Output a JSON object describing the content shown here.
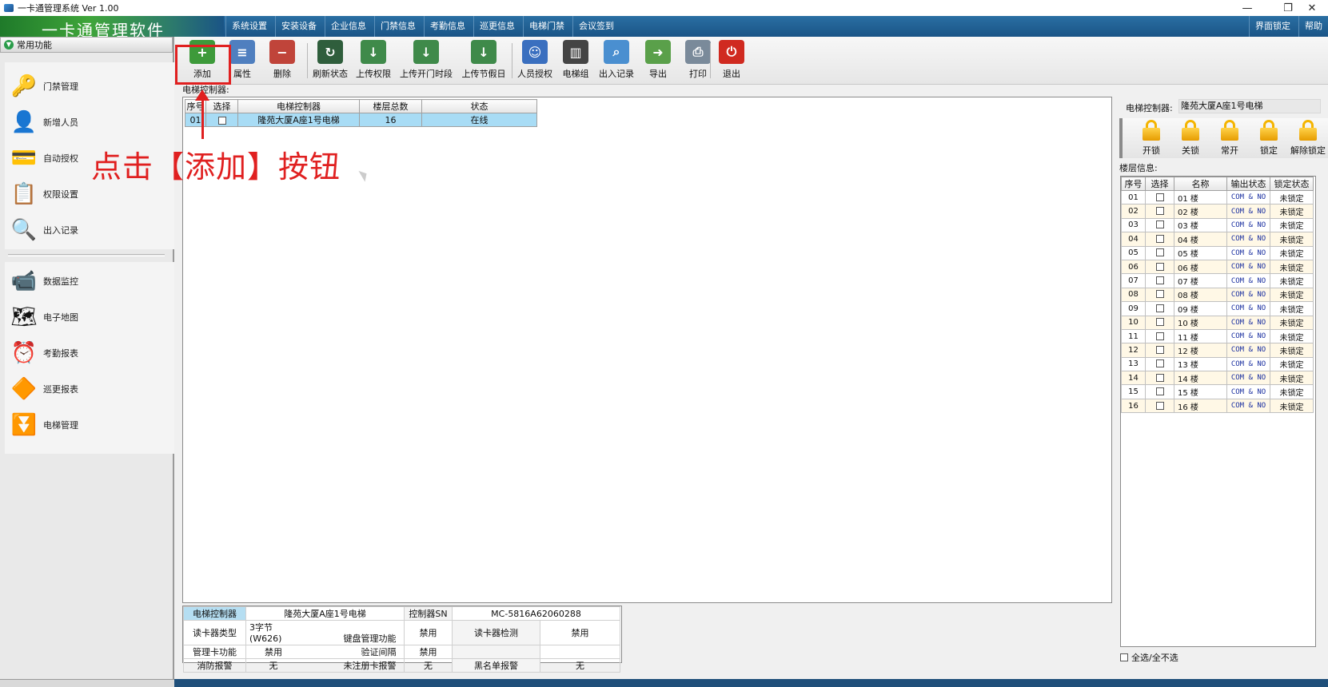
{
  "window": {
    "title": "一卡通管理系统 Ver 1.00",
    "minimize": "—",
    "restore": "❐",
    "close": "✕"
  },
  "menubar": {
    "logo": "一卡通管理软件",
    "items": [
      "系统设置",
      "安装设备",
      "企业信息",
      "门禁信息",
      "考勤信息",
      "巡更信息",
      "电梯门禁",
      "会议签到"
    ],
    "right_items": [
      "界面锁定",
      "帮助"
    ]
  },
  "sidebar": {
    "header": "常用功能",
    "items": [
      {
        "label": "门禁管理",
        "icon": "door-access-icon"
      },
      {
        "label": "新增人员",
        "icon": "person-icon"
      },
      {
        "label": "自动授权",
        "icon": "card-icon"
      },
      {
        "label": "权限设置",
        "icon": "permission-icon"
      },
      {
        "label": "出入记录",
        "icon": "magnifier-icon"
      },
      {
        "label": "数据监控",
        "icon": "camera-icon"
      },
      {
        "label": "电子地图",
        "icon": "map-icon"
      },
      {
        "label": "考勤报表",
        "icon": "clock-icon"
      },
      {
        "label": "巡更报表",
        "icon": "patrol-icon"
      },
      {
        "label": "电梯管理",
        "icon": "elevator-icon"
      }
    ]
  },
  "toolbar": {
    "buttons": [
      {
        "label": "添加",
        "icon": "add-icon",
        "color": "#3d9a3a",
        "glyph": "+"
      },
      {
        "label": "属性",
        "icon": "properties-icon",
        "color": "#4f7fbf",
        "glyph": "≡"
      },
      {
        "label": "删除",
        "icon": "delete-icon",
        "color": "#c0443a",
        "glyph": "−"
      },
      {
        "label": "刷新状态",
        "icon": "refresh-icon",
        "color": "#2f5e3c",
        "glyph": "↻"
      },
      {
        "label": "上传权限",
        "icon": "upload-permission-icon",
        "color": "#3f8a4a",
        "glyph": "↓"
      },
      {
        "label": "上传开门时段",
        "icon": "upload-timeslot-icon",
        "color": "#3f8a4a",
        "glyph": "↓"
      },
      {
        "label": "上传节假日",
        "icon": "upload-holiday-icon",
        "color": "#3f8a4a",
        "glyph": "↓"
      },
      {
        "label": "人员授权",
        "icon": "person-auth-icon",
        "color": "#3a6fbf",
        "glyph": "☺"
      },
      {
        "label": "电梯组",
        "icon": "elevator-group-icon",
        "color": "#444444",
        "glyph": "▥"
      },
      {
        "label": "出入记录",
        "icon": "records-search-icon",
        "color": "#4a8fd0",
        "glyph": "⌕"
      },
      {
        "label": "导出",
        "icon": "export-icon",
        "color": "#5aa04a",
        "glyph": "➜"
      },
      {
        "label": "打印",
        "icon": "print-icon",
        "color": "#7a8a9a",
        "glyph": "⎙"
      },
      {
        "label": "退出",
        "icon": "exit-icon",
        "color": "#d02a20",
        "glyph": "⏻"
      }
    ]
  },
  "main": {
    "caption": "电梯控制器:",
    "columns": [
      "序号",
      "选择",
      "电梯控制器",
      "楼层总数",
      "状态"
    ],
    "rows": [
      {
        "no": "01",
        "name": "隆苑大厦A座1号电梯",
        "floors": "16",
        "status": "在线"
      }
    ]
  },
  "annotation": {
    "text": "点击【添加】按钮"
  },
  "details": {
    "controller_label": "电梯控制器",
    "controller_value": "隆苑大厦A座1号电梯",
    "sn_label": "控制器SN",
    "sn_value": "MC-5816A62060288",
    "reader_type_label": "读卡器类型",
    "reader_type_value": "3字节(W626)",
    "keypad_label": "键盘管理功能",
    "keypad_value": "禁用",
    "reader_detect_label": "读卡器检测",
    "reader_detect_value": "禁用",
    "admin_card_label": "管理卡功能",
    "admin_card_value": "禁用",
    "verify_label": "验证间隔",
    "verify_value": "禁用",
    "fire_label": "消防报警",
    "fire_value": "无",
    "unreg_label": "未注册卡报警",
    "unreg_value": "无",
    "blacklist_label": "黑名单报警",
    "blacklist_value": "无"
  },
  "right": {
    "controller_label": "电梯控制器:",
    "controller_value": "隆苑大厦A座1号电梯",
    "lock_buttons": [
      "开锁",
      "关锁",
      "常开",
      "锁定",
      "解除锁定"
    ],
    "floor_caption": "楼层信息:",
    "floor_columns": [
      "序号",
      "选择",
      "名称",
      "输出状态",
      "锁定状态"
    ],
    "floors": [
      {
        "no": "01",
        "name": "01 楼",
        "out": "COM & NO",
        "lock": "未锁定"
      },
      {
        "no": "02",
        "name": "02 楼",
        "out": "COM & NO",
        "lock": "未锁定"
      },
      {
        "no": "03",
        "name": "03 楼",
        "out": "COM & NO",
        "lock": "未锁定"
      },
      {
        "no": "04",
        "name": "04 楼",
        "out": "COM & NO",
        "lock": "未锁定"
      },
      {
        "no": "05",
        "name": "05 楼",
        "out": "COM & NO",
        "lock": "未锁定"
      },
      {
        "no": "06",
        "name": "06 楼",
        "out": "COM & NO",
        "lock": "未锁定"
      },
      {
        "no": "07",
        "name": "07 楼",
        "out": "COM & NO",
        "lock": "未锁定"
      },
      {
        "no": "08",
        "name": "08 楼",
        "out": "COM & NO",
        "lock": "未锁定"
      },
      {
        "no": "09",
        "name": "09 楼",
        "out": "COM & NO",
        "lock": "未锁定"
      },
      {
        "no": "10",
        "name": "10 楼",
        "out": "COM & NO",
        "lock": "未锁定"
      },
      {
        "no": "11",
        "name": "11 楼",
        "out": "COM & NO",
        "lock": "未锁定"
      },
      {
        "no": "12",
        "name": "12 楼",
        "out": "COM & NO",
        "lock": "未锁定"
      },
      {
        "no": "13",
        "name": "13 楼",
        "out": "COM & NO",
        "lock": "未锁定"
      },
      {
        "no": "14",
        "name": "14 楼",
        "out": "COM & NO",
        "lock": "未锁定"
      },
      {
        "no": "15",
        "name": "15 楼",
        "out": "COM & NO",
        "lock": "未锁定"
      },
      {
        "no": "16",
        "name": "16 楼",
        "out": "COM & NO",
        "lock": "未锁定"
      }
    ],
    "select_all": "全选/全不选"
  }
}
